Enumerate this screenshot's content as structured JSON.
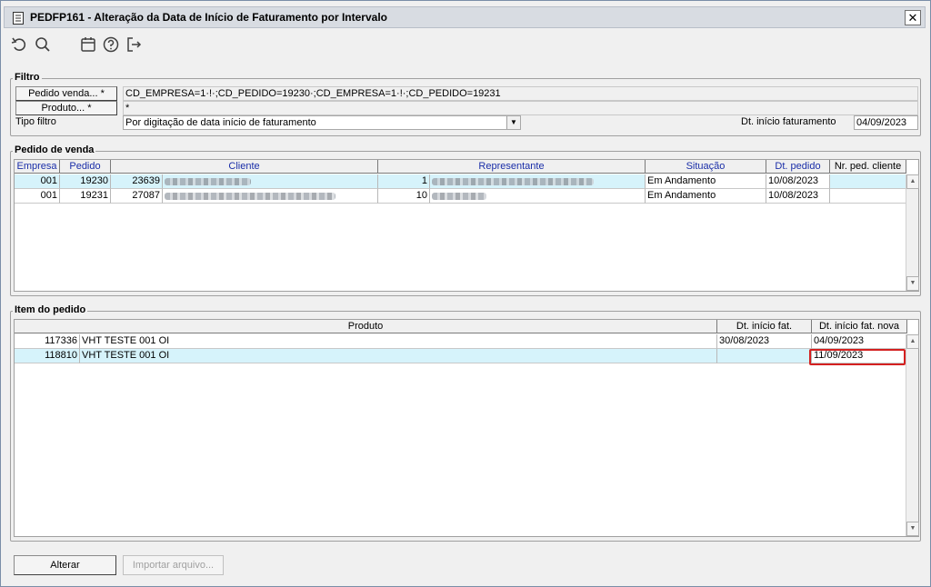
{
  "window": {
    "title": "PEDFP161 - Alteração da Data de Início de Faturamento por Intervalo",
    "close_label": "✕"
  },
  "toolbar": {
    "icons": [
      "undo-icon",
      "search-icon",
      "calendar-icon",
      "help-icon",
      "exit-icon"
    ]
  },
  "filtro": {
    "title": "Filtro",
    "pedido_venda_button": "Pedido venda... *",
    "pedido_venda_value": "CD_EMPRESA=1·!·;CD_PEDIDO=19230·;CD_EMPRESA=1·!·;CD_PEDIDO=19231",
    "produto_button": "Produto... *",
    "produto_value": "*",
    "tipo_filtro_label": "Tipo filtro",
    "tipo_filtro_value": "Por digitação de data início de faturamento",
    "dt_inicio_label": "Dt. início faturamento",
    "dt_inicio_value": "04/09/2023"
  },
  "pedido_venda": {
    "title": "Pedido de venda",
    "columns": [
      "Empresa",
      "Pedido",
      "Cliente",
      "Representante",
      "Situação",
      "Dt. pedido",
      "Nr. ped. cliente"
    ],
    "rows": [
      {
        "empresa": "001",
        "pedido": "19230",
        "cliente_cod": "23639",
        "repr_cod": "1",
        "situacao": "Em Andamento",
        "dt_pedido": "10/08/2023",
        "nr_ped_cliente": ""
      },
      {
        "empresa": "001",
        "pedido": "19231",
        "cliente_cod": "27087",
        "repr_cod": "10",
        "situacao": "Em Andamento",
        "dt_pedido": "10/08/2023",
        "nr_ped_cliente": ""
      }
    ]
  },
  "item_pedido": {
    "title": "Item do pedido",
    "columns": [
      "Produto",
      "Dt. início fat.",
      "Dt. início fat. nova"
    ],
    "rows": [
      {
        "codigo": "117336",
        "produto": "VHT TESTE 001 OI",
        "dt_inicio": "30/08/2023",
        "dt_nova": "04/09/2023"
      },
      {
        "codigo": "118810",
        "produto": "VHT TESTE 001 OI",
        "dt_inicio": "",
        "dt_nova": "11/09/2023"
      }
    ]
  },
  "footer": {
    "alterar_label": "Alterar",
    "importar_label": "Importar arquivo..."
  },
  "colors": {
    "selected_row": "#d6f3fb",
    "header_text": "#1a2ea8",
    "highlight": "#d42020"
  }
}
